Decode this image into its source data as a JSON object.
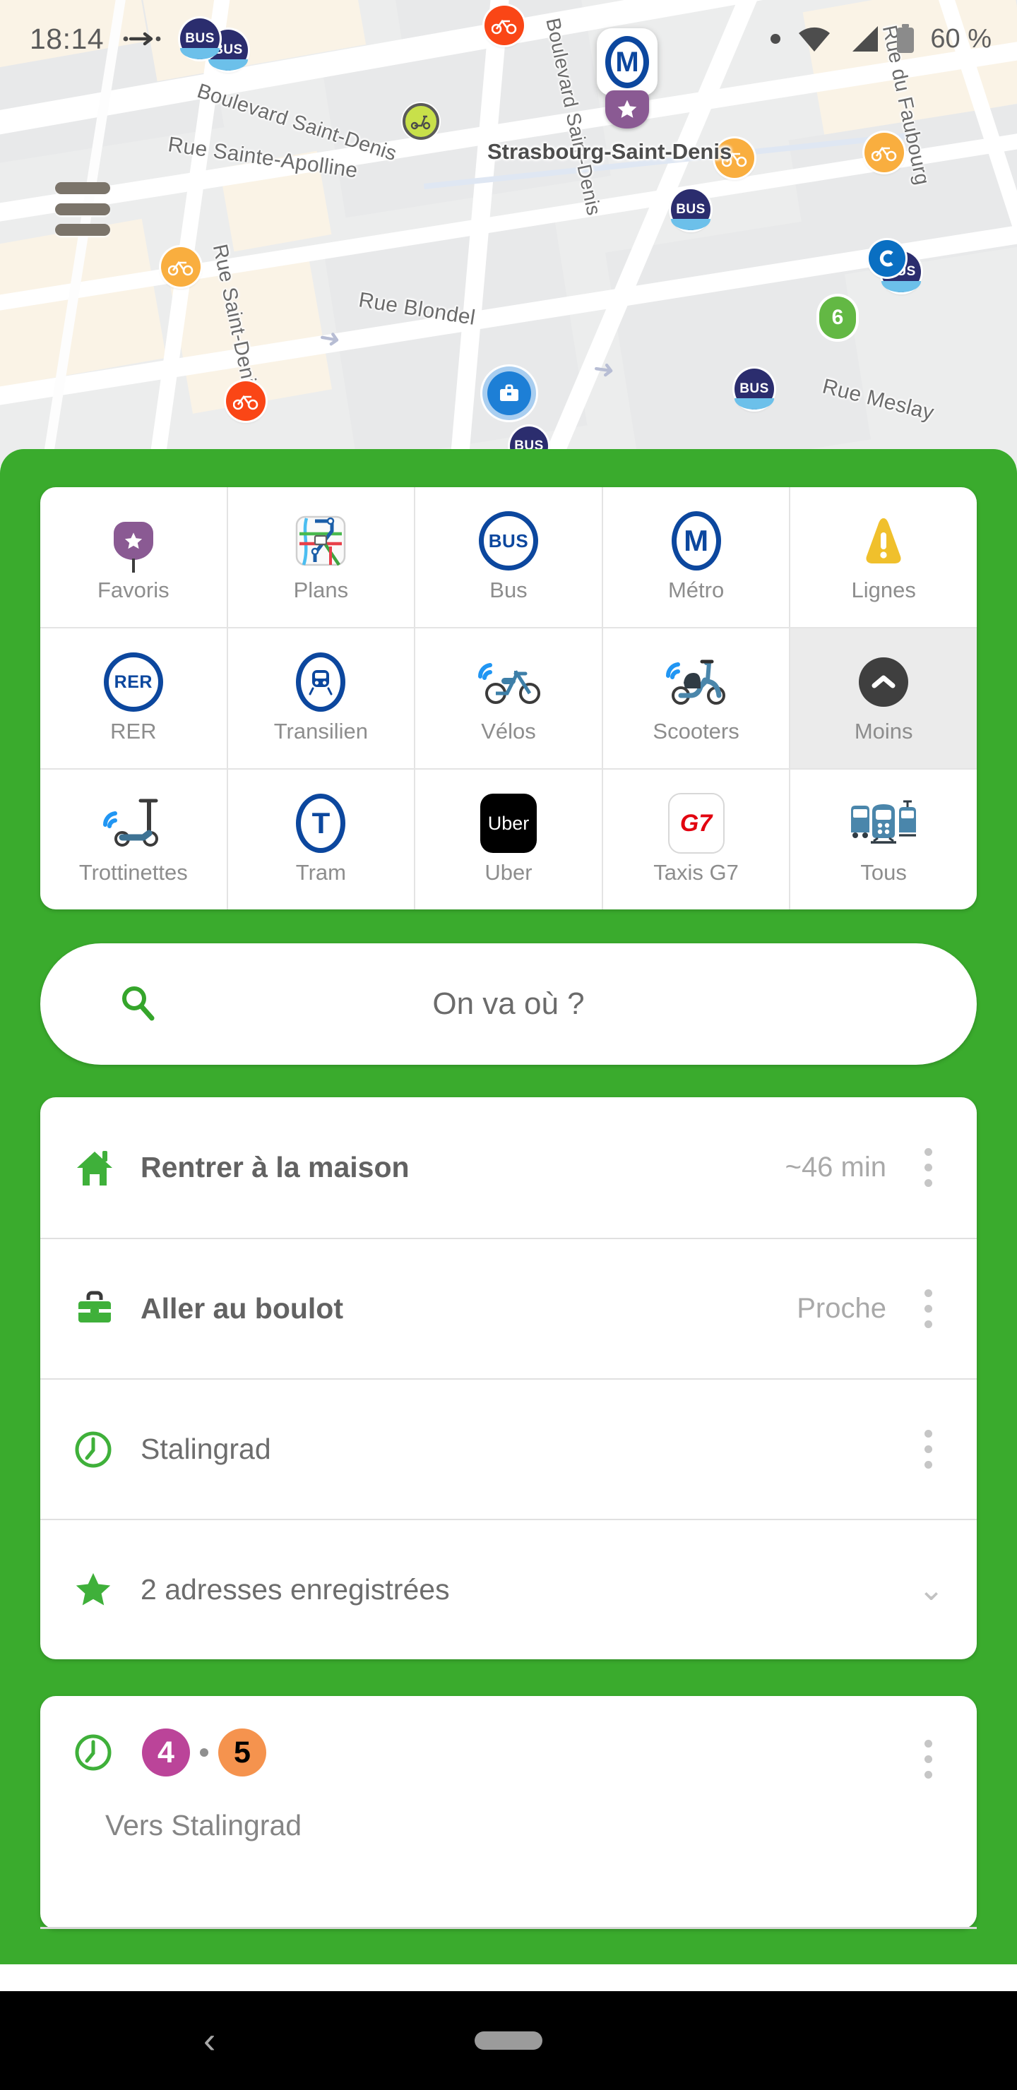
{
  "status_bar": {
    "time": "18:14",
    "location_icon": "location-arrow-icon",
    "bus_icon": "bus-badge-icon",
    "dot_icon": "dot-icon",
    "wifi_icon": "wifi-icon",
    "signal_icon": "cellular-signal-icon",
    "battery_icon": "battery-icon",
    "battery": "60 %"
  },
  "map": {
    "menu_icon": "hamburger-menu-icon",
    "station_label": "Strasbourg-Saint-Denis",
    "streets": [
      {
        "name": "Boulevard Saint-Denis"
      },
      {
        "name": "Rue Sainte-Apolline"
      },
      {
        "name": "Rue Blondel"
      },
      {
        "name": "Rue Saint-Denis"
      },
      {
        "name": "Rue Meslay"
      },
      {
        "name": "Rue du Faubourg"
      }
    ],
    "metro_marker_letter": "M",
    "favorite_marker_icon": "star-pin-icon",
    "bus_stop_label": "BUS",
    "green_stop_number": "6"
  },
  "modes": {
    "rows": [
      [
        {
          "label": "Favoris",
          "icon": "star-pin-icon",
          "active": false
        },
        {
          "label": "Plans",
          "icon": "map-plan-icon",
          "active": false
        },
        {
          "label": "Bus",
          "icon": "bus-ring-icon",
          "active": false
        },
        {
          "label": "Métro",
          "icon": "metro-ring-icon",
          "active": false
        },
        {
          "label": "Lignes",
          "icon": "warning-triangle-icon",
          "active": false
        }
      ],
      [
        {
          "label": "RER",
          "icon": "rer-ring-icon",
          "active": false
        },
        {
          "label": "Transilien",
          "icon": "transilien-ring-icon",
          "active": false
        },
        {
          "label": "Vélos",
          "icon": "bike-icon",
          "active": false
        },
        {
          "label": "Scooters",
          "icon": "scooter-icon",
          "active": false
        },
        {
          "label": "Moins",
          "icon": "chevron-up-circle-icon",
          "active": true
        }
      ],
      [
        {
          "label": "Trottinettes",
          "icon": "kick-scooter-icon",
          "active": false
        },
        {
          "label": "Tram",
          "icon": "tram-ring-icon",
          "active": false
        },
        {
          "label": "Uber",
          "icon": "uber-logo-icon",
          "active": false
        },
        {
          "label": "Taxis G7",
          "icon": "g7-logo-icon",
          "active": false
        },
        {
          "label": "Tous",
          "icon": "all-transport-icon",
          "active": false
        }
      ]
    ],
    "uber_wordmark": "Uber",
    "g7_wordmark": "G7",
    "bus_ring_text": "BUS",
    "metro_ring_text": "M",
    "rer_ring_text": "RER",
    "tram_ring_text": "T"
  },
  "search": {
    "icon": "search-icon",
    "placeholder": "On va où ?"
  },
  "favorites": {
    "items": [
      {
        "title": "Rentrer à la maison",
        "meta": "~46 min",
        "icon": "home-icon",
        "trailing": "kebab-menu-icon",
        "bold": true
      },
      {
        "title": "Aller au boulot",
        "meta": "Proche",
        "icon": "briefcase-icon",
        "trailing": "kebab-menu-icon",
        "bold": true
      },
      {
        "title": "Stalingrad",
        "meta": "",
        "icon": "clock-icon",
        "trailing": "kebab-menu-icon",
        "bold": false
      },
      {
        "title": "2 adresses enregistrées",
        "meta": "",
        "icon": "star-icon",
        "trailing": "chevron-down-icon",
        "bold": false
      }
    ]
  },
  "recent_line": {
    "icon": "clock-icon",
    "badges": [
      {
        "label": "4",
        "color": "#bb4499",
        "text_color": "#ffffff"
      },
      {
        "label": "5",
        "color": "#f5934e",
        "text_color": "#000000"
      }
    ],
    "separator": "·",
    "subtitle": "Vers Stalingrad",
    "trailing": "kebab-menu-icon"
  },
  "nav_bar": {
    "back_icon": "back-chevron-icon",
    "home_icon": "home-pill-icon"
  },
  "colors": {
    "brand_green": "#3aab2d",
    "ratp_blue": "#0c479e",
    "accent_yellow": "#f0c02c",
    "line4_purple": "#bb4499",
    "line5_orange": "#f5934e"
  }
}
